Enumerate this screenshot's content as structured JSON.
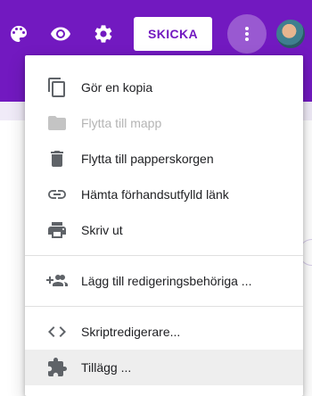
{
  "header": {
    "send_label": "SKICKA",
    "accent": "#7219c0",
    "icons": [
      "palette-icon",
      "eye-icon",
      "gear-icon",
      "more-vert-icon"
    ]
  },
  "menu": {
    "items": [
      {
        "label": "Gör en kopia",
        "icon": "copy-icon",
        "enabled": true
      },
      {
        "label": "Flytta till mapp",
        "icon": "folder-icon",
        "enabled": false
      },
      {
        "label": "Flytta till papperskorgen",
        "icon": "trash-icon",
        "enabled": true
      },
      {
        "label": "Hämta förhandsutfylld länk",
        "icon": "link-icon",
        "enabled": true
      },
      {
        "label": "Skriv ut",
        "icon": "print-icon",
        "enabled": true
      },
      {
        "label": "Lägg till redigeringsbehöriga ...",
        "icon": "add-people-icon",
        "enabled": true
      },
      {
        "label": "Skriptredigerare...",
        "icon": "code-icon",
        "enabled": true
      },
      {
        "label": "Tillägg ...",
        "icon": "puzzle-icon",
        "enabled": true
      }
    ]
  }
}
